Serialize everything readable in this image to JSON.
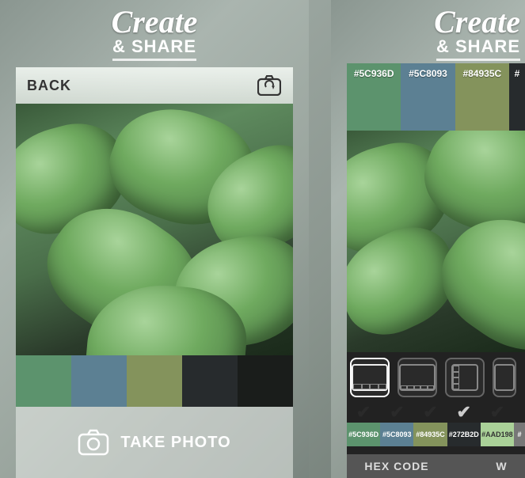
{
  "header": {
    "create": "Create",
    "share": "& SHARE"
  },
  "left": {
    "back_label": "BACK",
    "take_photo_label": "TAKE PHOTO",
    "palette": [
      {
        "hex": "#5C936D"
      },
      {
        "hex": "#5C8093"
      },
      {
        "hex": "#84935C"
      },
      {
        "hex": "#272B2D"
      },
      {
        "hex": "#1A1D1B"
      }
    ]
  },
  "right": {
    "swatches_top": [
      {
        "label": "#5C936D",
        "hex": "#5C936D"
      },
      {
        "label": "#5C8093",
        "hex": "#5C8093"
      },
      {
        "label": "#84935C",
        "hex": "#84935C"
      },
      {
        "label": "#",
        "hex": "#272B2D"
      }
    ],
    "checks": [
      {
        "label": "#5C936D",
        "hex": "#5C936D",
        "checked": true
      },
      {
        "label": "#5C8093",
        "hex": "#5C8093",
        "checked": true
      },
      {
        "label": "#84935C",
        "hex": "#84935C",
        "checked": true
      },
      {
        "label": "#272B2D",
        "hex": "#272B2D",
        "checked": true
      },
      {
        "label": "#AAD198",
        "hex": "#AAD198",
        "checked": true
      },
      {
        "label": "#",
        "hex": "#777",
        "checked": false
      }
    ],
    "hexcode_label": "HEX CODE",
    "w_label": "W"
  }
}
